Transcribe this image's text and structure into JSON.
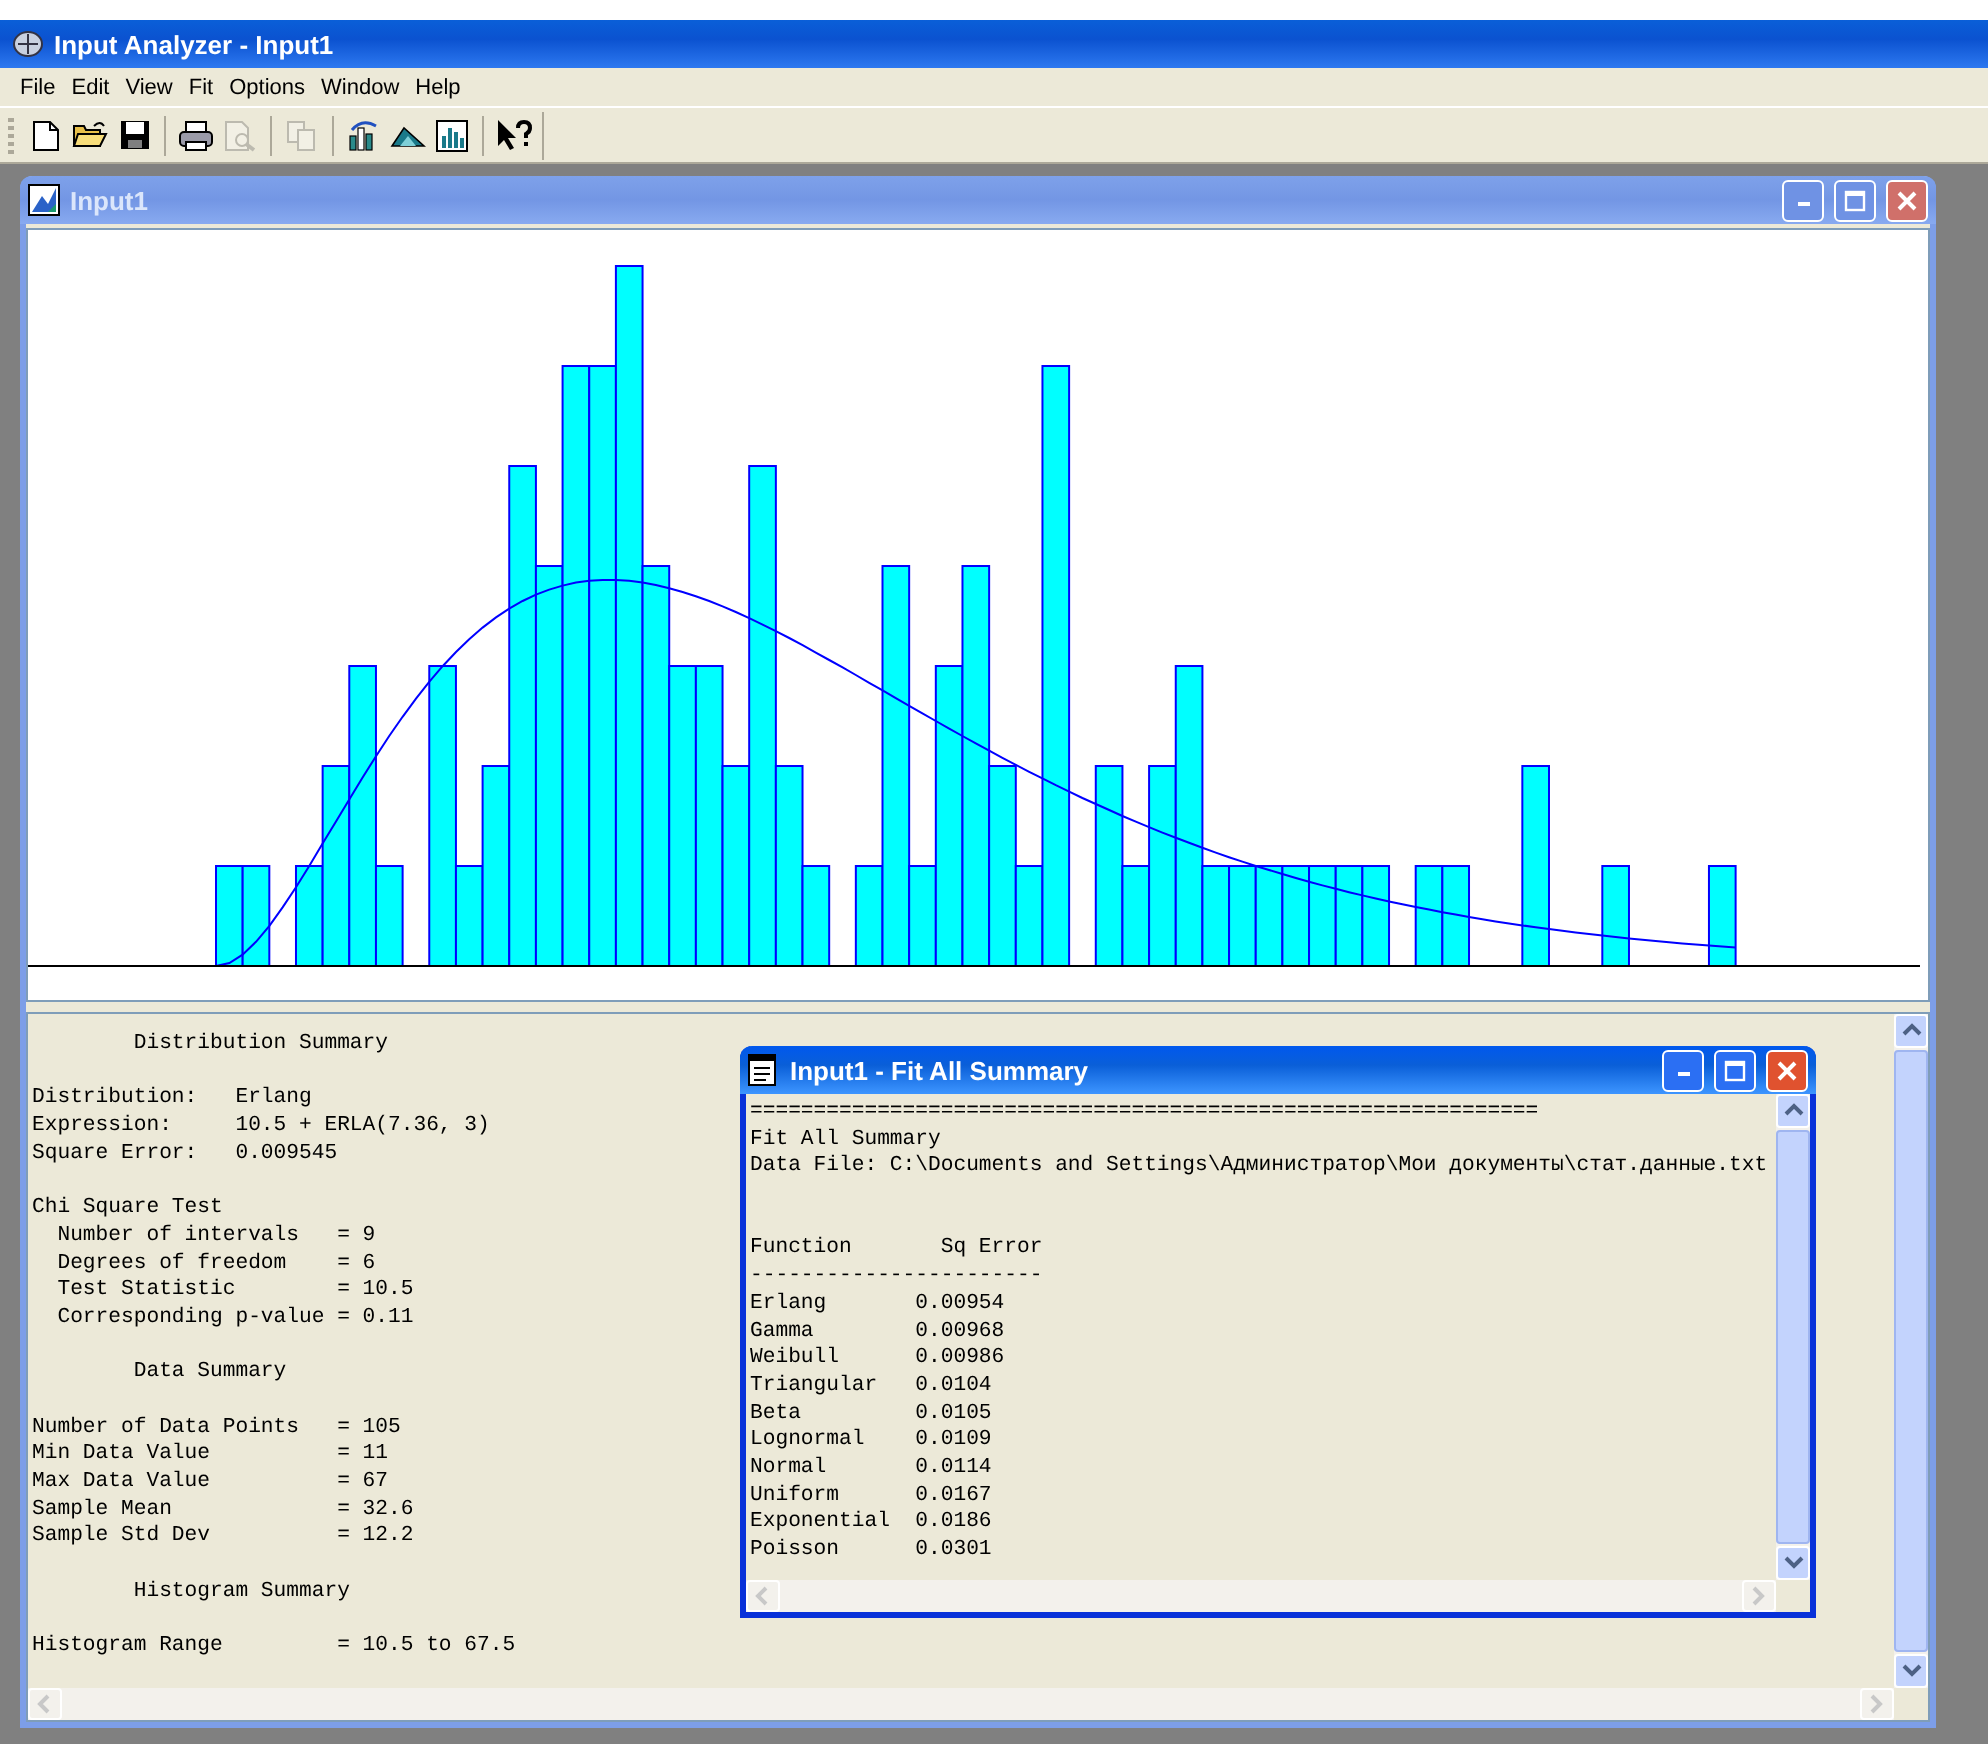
{
  "window": {
    "title": "Input Analyzer - Input1"
  },
  "menu": [
    {
      "label": "File"
    },
    {
      "label": "Edit"
    },
    {
      "label": "View"
    },
    {
      "label": "Fit"
    },
    {
      "label": "Options"
    },
    {
      "label": "Window"
    },
    {
      "label": "Help"
    }
  ],
  "toolbar": [
    [
      {
        "kind": "new",
        "disabled": false
      },
      {
        "kind": "open",
        "disabled": false
      },
      {
        "kind": "save",
        "disabled": false
      }
    ],
    [
      {
        "kind": "print",
        "disabled": false
      },
      {
        "kind": "preview",
        "disabled": true
      }
    ],
    [
      {
        "kind": "copy",
        "disabled": true
      }
    ],
    [
      {
        "kind": "fit",
        "disabled": false
      },
      {
        "kind": "triangle",
        "disabled": false
      },
      {
        "kind": "chart",
        "disabled": false
      }
    ],
    [
      {
        "kind": "help",
        "disabled": false
      }
    ]
  ],
  "child_window": {
    "title": "Input1",
    "summary": [
      [
        "        Distribution Summary"
      ],
      [
        "Distribution:   Erlang",
        "Expression:     10.5 + ERLA(7.36, 3)",
        "Square Error:   0.009545"
      ],
      [
        "Chi Square Test",
        "  Number of intervals   = 9",
        "  Degrees of freedom    = 6",
        "  Test Statistic        = 10.5",
        "  Corresponding p-value = 0.11"
      ],
      [
        "        Data Summary"
      ],
      [
        "Number of Data Points   = 105",
        "Min Data Value          = 11",
        "Max Data Value          = 67",
        "Sample Mean             = 32.6",
        "Sample Std Dev          = 12.2"
      ],
      [
        "        Histogram Summary"
      ],
      [
        "Histogram Range         = 10.5 to 67.5"
      ]
    ]
  },
  "fit_window": {
    "title": "Input1 - Fit All Summary",
    "header_lines": [
      "==============================================================",
      "Fit All Summary",
      "Data File: C:\\Documents and Settings\\Администратор\\Мои документы\\стат.данные.txt"
    ],
    "columns": [
      "Function",
      "Sq Error"
    ],
    "rule": "-----------------------",
    "rows": [
      {
        "function": "Erlang",
        "sq_error": "0.00954"
      },
      {
        "function": "Gamma",
        "sq_error": "0.00968"
      },
      {
        "function": "Weibull",
        "sq_error": "0.00986"
      },
      {
        "function": "Triangular",
        "sq_error": "0.0104"
      },
      {
        "function": "Beta",
        "sq_error": "0.0105"
      },
      {
        "function": "Lognormal",
        "sq_error": "0.0109"
      },
      {
        "function": "Normal",
        "sq_error": "0.0114"
      },
      {
        "function": "Uniform",
        "sq_error": "0.0167"
      },
      {
        "function": "Exponential",
        "sq_error": "0.0186"
      },
      {
        "function": "Poisson",
        "sq_error": "0.0301"
      }
    ]
  }
}
